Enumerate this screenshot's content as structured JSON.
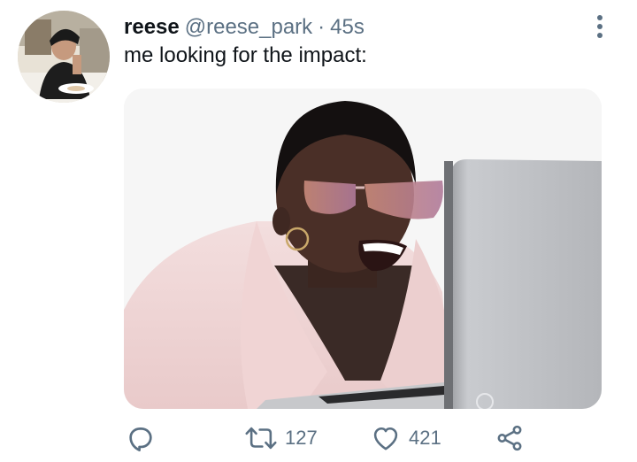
{
  "tweet": {
    "display_name": "reese",
    "handle": "@reese_park",
    "separator": "·",
    "time": "45s",
    "text": "me looking for the impact:",
    "media_description": "",
    "actions": {
      "reply_count": "",
      "retweet_count": "127",
      "like_count": "421"
    }
  },
  "icons": {
    "reply": "reply-icon",
    "retweet": "retweet-icon",
    "like": "heart-icon",
    "share": "share-icon",
    "more": "more-vertical-icon"
  },
  "colors": {
    "text_primary": "#0f1419",
    "text_secondary": "#5b7083",
    "background": "#ffffff"
  }
}
